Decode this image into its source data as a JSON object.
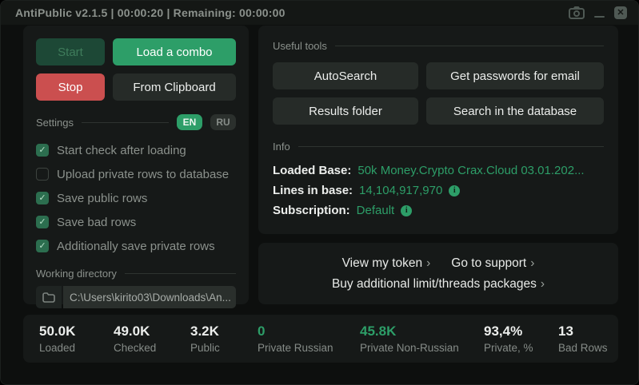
{
  "window": {
    "title": "AntiPublic v2.1.5 | 00:00:20 | Remaining: 00:00:00",
    "close_glyph": "✕"
  },
  "left_panel": {
    "buttons": {
      "start": "Start",
      "load_combo": "Load a combo",
      "stop": "Stop",
      "from_clipboard": "From Clipboard"
    },
    "settings": {
      "label": "Settings",
      "languages": [
        {
          "label": "EN",
          "active": true
        },
        {
          "label": "RU",
          "active": false
        }
      ],
      "checkboxes": [
        {
          "label": "Start check after loading",
          "checked": true
        },
        {
          "label": "Upload private rows to database",
          "checked": false
        },
        {
          "label": "Save public rows",
          "checked": true
        },
        {
          "label": "Save bad rows",
          "checked": true
        },
        {
          "label": "Additionally save private rows",
          "checked": true
        }
      ],
      "check_glyph": "✓"
    },
    "working_directory": {
      "label": "Working directory",
      "path": "C:\\Users\\kirito03\\Downloads\\An..."
    }
  },
  "tools_panel": {
    "useful_tools_label": "Useful tools",
    "buttons": [
      "AutoSearch",
      "Get passwords for email",
      "Results folder",
      "Search in the database"
    ],
    "info_label": "Info",
    "info_rows": [
      {
        "label": "Loaded Base:",
        "value": "50k Money.Crypto Crax.Cloud 03.01.202...",
        "has_info_icon": false
      },
      {
        "label": "Lines in base:",
        "value": "14,104,917,970",
        "has_info_icon": true
      },
      {
        "label": "Subscription:",
        "value": "Default",
        "has_info_icon": true
      }
    ],
    "info_icon_glyph": "i"
  },
  "links_panel": {
    "links": [
      "View my token",
      "Go to support",
      "Buy additional limit/threads packages"
    ],
    "chevron": "›"
  },
  "stats_bar": {
    "items": [
      {
        "value": "50.0K",
        "label": "Loaded",
        "green": false
      },
      {
        "value": "49.0K",
        "label": "Checked",
        "green": false
      },
      {
        "value": "3.2K",
        "label": "Public",
        "green": false
      },
      {
        "value": "0",
        "label": "Private Russian",
        "green": true
      },
      {
        "value": "45.8K",
        "label": "Private Non-Russian",
        "green": true
      },
      {
        "value": "93,4%",
        "label": "Private, %",
        "green": false
      },
      {
        "value": "13",
        "label": "Bad Rows",
        "green": false
      }
    ]
  },
  "colors": {
    "accent_green": "#2d9e68",
    "stop_red": "#cb4f4f",
    "panel_bg": "#161918",
    "window_bg": "#0d0f0e"
  }
}
